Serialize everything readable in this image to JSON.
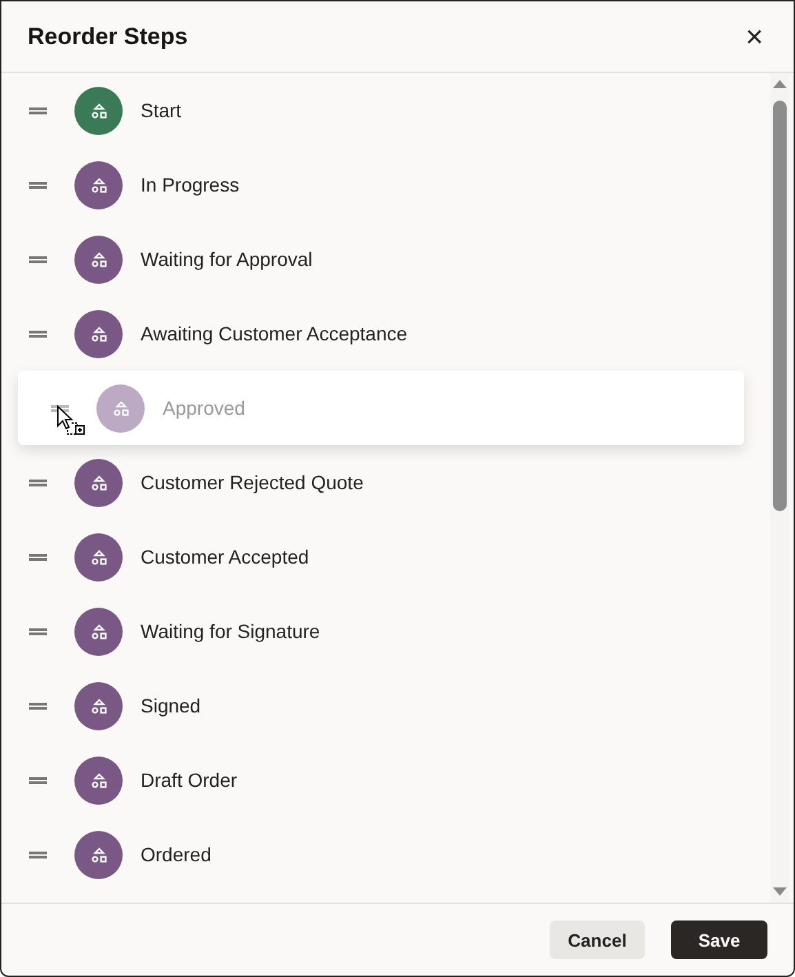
{
  "dialog": {
    "title": "Reorder Steps",
    "close": "×"
  },
  "steps": [
    {
      "label": "Start",
      "color": "#3b7a57",
      "dragging": false
    },
    {
      "label": "In Progress",
      "color": "#7a5886",
      "dragging": false
    },
    {
      "label": "Waiting for Approval",
      "color": "#7a5886",
      "dragging": false
    },
    {
      "label": "Awaiting Customer Acceptance",
      "color": "#7a5886",
      "dragging": false
    },
    {
      "label": "Approved",
      "color": "#bca9c3",
      "dragging": true
    },
    {
      "label": "Customer Rejected Quote",
      "color": "#7a5886",
      "dragging": false
    },
    {
      "label": "Customer Accepted",
      "color": "#7a5886",
      "dragging": false
    },
    {
      "label": "Waiting for Signature",
      "color": "#7a5886",
      "dragging": false
    },
    {
      "label": "Signed",
      "color": "#7a5886",
      "dragging": false
    },
    {
      "label": "Draft Order",
      "color": "#7a5886",
      "dragging": false
    },
    {
      "label": "Ordered",
      "color": "#7a5886",
      "dragging": false
    }
  ],
  "buttons": {
    "cancel": "Cancel",
    "save": "Save"
  }
}
